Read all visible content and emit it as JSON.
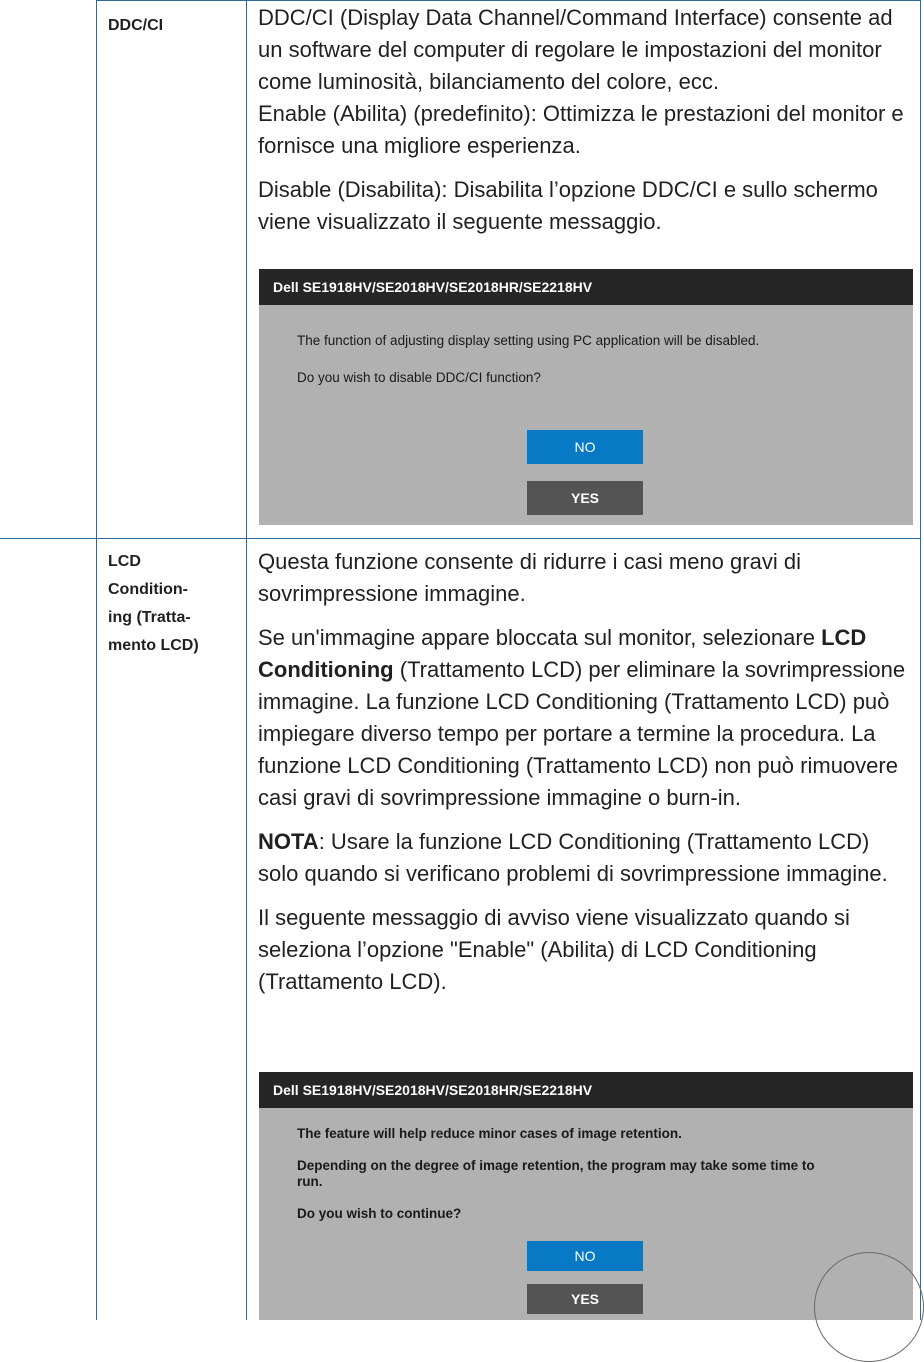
{
  "rows": [
    {
      "label": "DDC/CI",
      "paragraphs": [
        "DDC/CI (Display Data Channel/Command Interface) consente ad un software del computer di regolare le impostazioni del monitor come luminosità, bilanciamento del colore, ecc.",
        "Enable (Abilita) (predefinito): Ottimizza le prestazioni del monitor e fornisce una migliore esperienza.",
        "Disable (Disabilita): Disabilita l’opzione DDC/CI e sullo schermo viene visualizzato il seguente messaggio."
      ],
      "dialog": {
        "title": "Dell SE1918HV/SE2018HV/SE2018HR/SE2218HV",
        "messages": [
          "The function of adjusting display setting using PC application will be disabled.",
          "Do you wish to disable DDC/CI function?"
        ],
        "no_label": "NO",
        "yes_label": "YES"
      }
    },
    {
      "label_lines": [
        "LCD",
        "Condition-",
        "ing (Tratta-",
        "mento LCD)"
      ],
      "paragraphs": [
        "Questa funzione consente di ridurre i casi meno gravi di sovrimpressione immagine."
      ],
      "p2_before": "Se un'immagine appare bloccata sul monitor, selezionare ",
      "p2_bold": "LCD Conditioning",
      "p2_after": " (Trattamento LCD) per eliminare la sovrimpressione immagine. La funzione LCD Conditioning (Trattamento LCD) può impiegare diverso tempo per portare a termine la procedura. La funzione LCD Conditioning (Trattamento LCD) non può rimuovere casi gravi di sovrimpressione immagine o burn-in.",
      "note_bold": "NOTA",
      "note_text": ": Usare la funzione LCD Conditioning (Trattamento LCD) solo quando si verificano problemi di sovrimpressione immagine.",
      "p4": "Il seguente messaggio di avviso viene visualizzato quando si seleziona l’opzione \"Enable\" (Abilita) di LCD Conditioning (Trattamento LCD).",
      "dialog": {
        "title": "Dell SE1918HV/SE2018HV/SE2018HR/SE2218HV",
        "messages": [
          "The feature will help reduce minor cases of image retention.",
          "Depending on the degree of image retention, the program may take some time to run.",
          "Do you wish to continue?"
        ],
        "no_label": "NO",
        "yes_label": "YES"
      }
    }
  ],
  "colors": {
    "table_border": "#2d6a9a",
    "dialog_bg": "#b1b1b1",
    "dialog_title_bg": "#262626",
    "no_button": "#0879c5",
    "yes_button": "#545454"
  }
}
